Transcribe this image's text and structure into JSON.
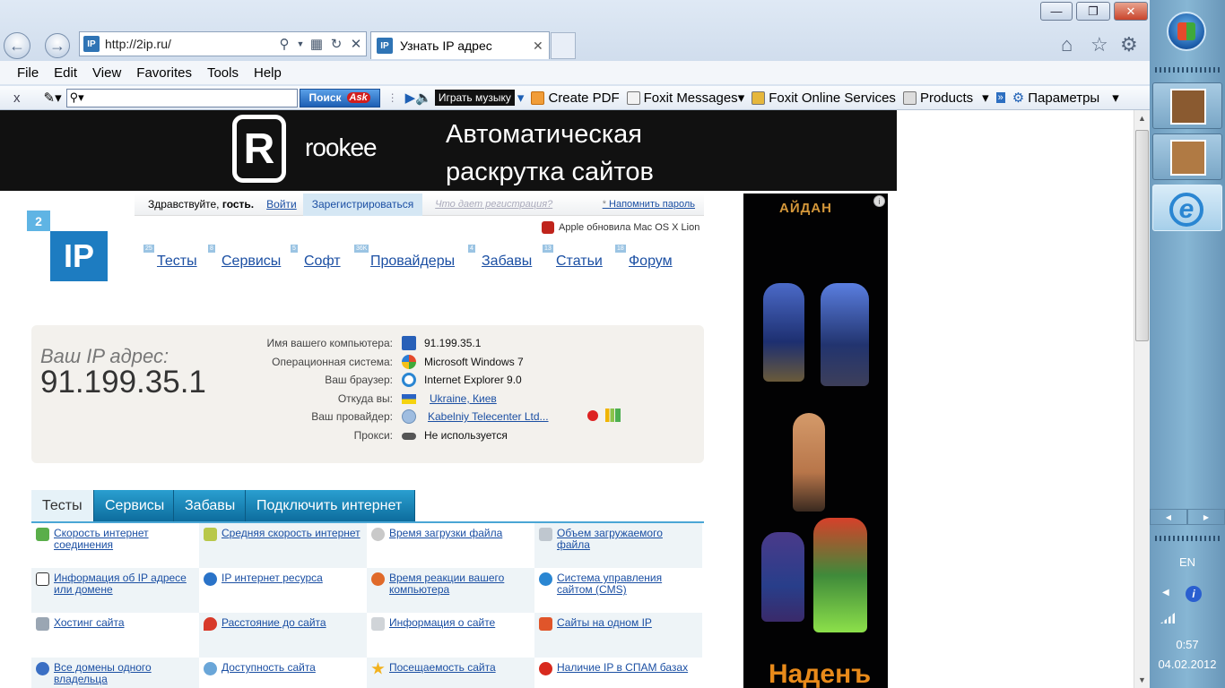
{
  "window": {
    "minimize": "—",
    "maximize": "❐",
    "close": "✕"
  },
  "address": {
    "favicon": "IP",
    "url": "http://2ip.ru/"
  },
  "tab": {
    "favicon": "IP",
    "title": "Узнать IP адрес",
    "close": "✕"
  },
  "menu": [
    "File",
    "Edit",
    "View",
    "Favorites",
    "Tools",
    "Help"
  ],
  "toolbar": {
    "close": "x",
    "search_button": "Поиск",
    "ask_logo": "Ask",
    "music": "Играть музыку",
    "create_pdf": "Create PDF",
    "foxit_messages": "Foxit Messages",
    "foxit_online": "Foxit Online Services",
    "products": "Products",
    "params": "Параметры"
  },
  "banner": {
    "logo_letter": "R",
    "brand": "rookee",
    "slogan_line1": "Автоматическая",
    "slogan_line2": "раскрутка сайтов"
  },
  "login": {
    "hello_prefix": "Здравствуйте, ",
    "hello_user": "гость.",
    "login": "Войти",
    "register": "Зарегистрироваться",
    "why": "Что дает регистрация?",
    "remind": "Напомнить пароль"
  },
  "news": "Apple обновила Mac OS X Lion",
  "site_logo": {
    "two": "2",
    "ip": "IP"
  },
  "topnav": [
    {
      "count": "25",
      "label": "Тесты"
    },
    {
      "count": "8",
      "label": "Сервисы"
    },
    {
      "count": "5",
      "label": "Софт"
    },
    {
      "count": "36K",
      "label": "Провайдеры"
    },
    {
      "count": "4",
      "label": "Забавы"
    },
    {
      "count": "13",
      "label": "Статьи"
    },
    {
      "count": "18",
      "label": "Форум"
    }
  ],
  "ipbox": {
    "caption": "Ваш IP адрес:",
    "ip": "91.199.35.1",
    "rows": [
      {
        "key": "Имя вашего компьютера:",
        "value": "91.199.35.1"
      },
      {
        "key": "Операционная система:",
        "value": "Microsoft Windows 7"
      },
      {
        "key": "Ваш браузер:",
        "value": "Internet Explorer 9.0"
      },
      {
        "key": "Откуда вы:",
        "value": "Ukraine, Киев"
      },
      {
        "key": "Ваш провайдер:",
        "value": "Kabelniy Telecenter Ltd..."
      },
      {
        "key": "Прокси:",
        "value": "Не используется"
      }
    ]
  },
  "tabs": [
    "Тесты",
    "Сервисы",
    "Забавы",
    "Подключить интернет"
  ],
  "grid": [
    "Скорость интернет соединения",
    "Средняя скорость интернет",
    "Время загрузки файла",
    "Объем загружаемого файла",
    "Информация об IP адресе или домене",
    "IP интернет ресурса",
    "Время реакции вашего компьютера",
    "Система управления сайтом (CMS)",
    "Хостинг сайта",
    "Расстояние до сайта",
    "Информация о сайте",
    "Сайты на одном IP",
    "Все домены одного владельца",
    "Доступность сайта",
    "Посещаемость сайта",
    "Наличие IP в СПАМ базах"
  ],
  "ad": {
    "title": "АЙДАН",
    "bottom": "Наденъ",
    "info": "i"
  },
  "taskbar": {
    "lang": "EN",
    "time": "0:57",
    "date": "04.02.2012"
  },
  "colors": {
    "link": "#1b4fa3",
    "tab_active_bg": "#e6f2f8",
    "tab_bg": "#0c6b9c",
    "ipbox_bg": "#f3f1ed",
    "logo_blue": "#1d7cc1"
  }
}
